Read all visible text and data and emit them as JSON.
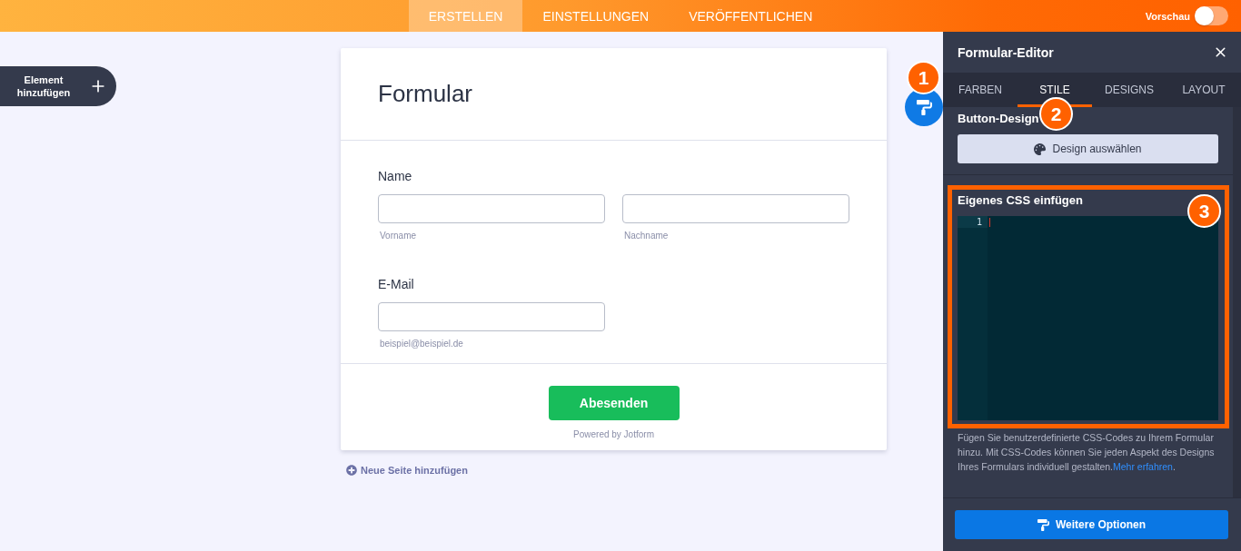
{
  "top_bar": {
    "tabs": [
      {
        "label": "ERSTELLEN",
        "selected": true
      },
      {
        "label": "EINSTELLUNGEN",
        "selected": false
      },
      {
        "label": "VERÖFFENTLICHEN",
        "selected": false
      }
    ],
    "preview": {
      "label": "Vorschau",
      "on": false
    }
  },
  "add_element": {
    "label": "Element hinzufügen"
  },
  "form": {
    "title": "Formular",
    "fields": [
      {
        "label": "Name",
        "inputs": [
          {
            "sublabel": "Vorname"
          },
          {
            "sublabel": "Nachname"
          }
        ]
      },
      {
        "label": "E-Mail",
        "inputs": [
          {
            "sublabel": "beispiel@beispiel.de"
          }
        ]
      }
    ],
    "submit": "Abesenden",
    "powered_by": "Powered by Jotform"
  },
  "add_page": {
    "label": "Neue Seite hinzufügen"
  },
  "editor": {
    "title": "Formular-Editor",
    "tabs": [
      {
        "label": "FARBEN",
        "selected": false
      },
      {
        "label": "STILE",
        "selected": true
      },
      {
        "label": "DESIGNS",
        "selected": false
      },
      {
        "label": "LAYOUT",
        "selected": false
      }
    ],
    "button_design": {
      "heading": "Button-Design",
      "button": "Design auswählen"
    },
    "custom_css": {
      "heading": "Eigenes CSS einfügen",
      "line_numbers": [
        "1"
      ],
      "description": "Fügen Sie benutzerdefinierte CSS-Codes zu Ihrem Formular hinzu. Mit CSS-Codes können Sie jeden Aspekt des Designs Ihres Formulars individuell gestalten.",
      "link": "Mehr erfahren",
      "description_end": "."
    },
    "more_options": "Weitere Optionen"
  },
  "annotations": [
    {
      "label": "1"
    },
    {
      "label": "2"
    },
    {
      "label": "3"
    }
  ]
}
